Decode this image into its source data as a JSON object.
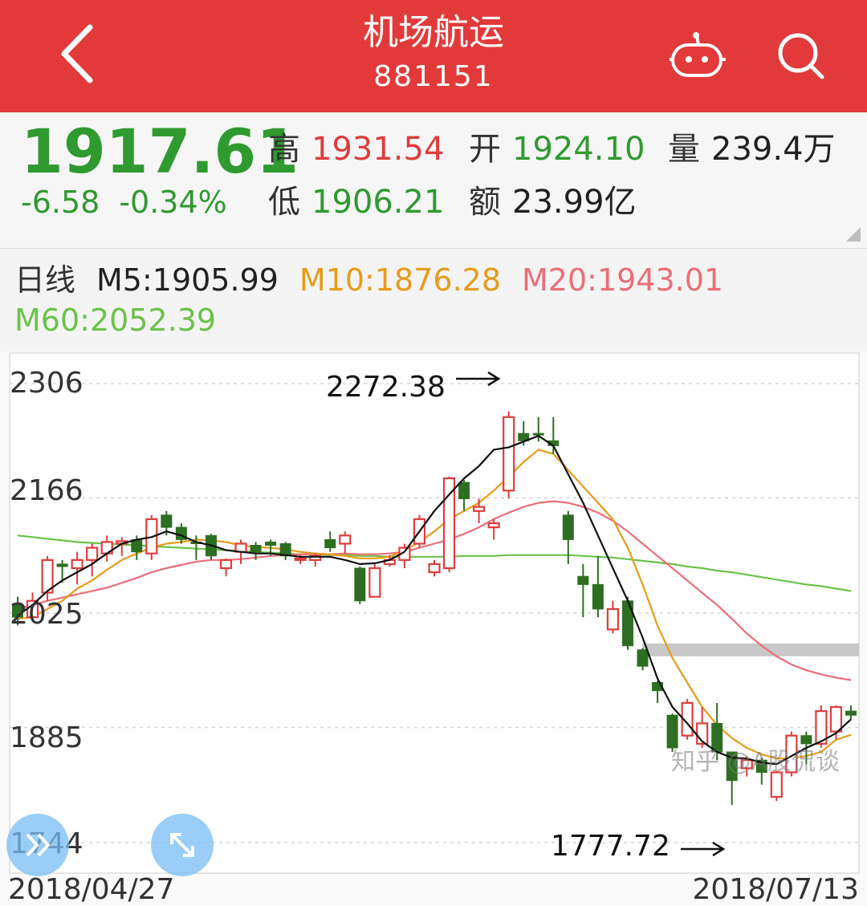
{
  "header": {
    "title": "机场航运",
    "code": "881151",
    "background": "#e23a3a"
  },
  "icons": {
    "back": "chevron-left-icon",
    "robot": "robot-icon",
    "search": "search-icon",
    "expand": "double-chevron-right-icon",
    "fullscreen": "expand-arrows-icon"
  },
  "quote": {
    "price": "1917.61",
    "change": "-6.58",
    "change_pct": "-0.34%",
    "high_label": "高",
    "high": "1931.54",
    "open_label": "开",
    "open": "1924.10",
    "volume_label": "量",
    "volume": "239.4万",
    "low_label": "低",
    "low": "1906.21",
    "amount_label": "额",
    "amount": "23.99亿"
  },
  "ma": {
    "kind": "日线",
    "m5": "M5:1905.99",
    "m10": "M10:1876.28",
    "m20": "M20:1943.01",
    "m60": "M60:2052.39"
  },
  "chart_data": {
    "type": "candlestick",
    "y_ticks": [
      "2306",
      "2166",
      "2025",
      "1885",
      "1744"
    ],
    "ylim": [
      1744,
      2306
    ],
    "x_start_label": "2018/04/27",
    "x_end_label": "2018/07/13",
    "high_annotation": "2272.38",
    "low_annotation": "1777.72",
    "colors": {
      "up": "#e03c3c",
      "down": "#2e6e22",
      "m5": "#111111",
      "m10": "#e89b1a",
      "m20": "#ec6e78",
      "m60": "#6cc24a"
    },
    "candles": [
      [
        2035,
        2020,
        2045,
        2010
      ],
      [
        2020,
        2040,
        2050,
        2015
      ],
      [
        2050,
        2090,
        2095,
        2040
      ],
      [
        2085,
        2082,
        2090,
        2062
      ],
      [
        2080,
        2090,
        2100,
        2060
      ],
      [
        2090,
        2105,
        2110,
        2070
      ],
      [
        2098,
        2112,
        2120,
        2088
      ],
      [
        2110,
        2113,
        2118,
        2095
      ],
      [
        2115,
        2100,
        2120,
        2090
      ],
      [
        2098,
        2140,
        2145,
        2090
      ],
      [
        2145,
        2130,
        2150,
        2120
      ],
      [
        2130,
        2115,
        2135,
        2110
      ],
      [
        2112,
        2110,
        2120,
        2090
      ],
      [
        2120,
        2095,
        2122,
        2090
      ],
      [
        2080,
        2090,
        2092,
        2070
      ],
      [
        2100,
        2110,
        2115,
        2085
      ],
      [
        2108,
        2100,
        2112,
        2090
      ],
      [
        2112,
        2108,
        2115,
        2095
      ],
      [
        2110,
        2095,
        2112,
        2090
      ],
      [
        2090,
        2092,
        2096,
        2085
      ],
      [
        2090,
        2095,
        2098,
        2082
      ],
      [
        2115,
        2105,
        2125,
        2100
      ],
      [
        2110,
        2120,
        2125,
        2098
      ],
      [
        2080,
        2040,
        2082,
        2036
      ],
      [
        2045,
        2080,
        2085,
        2045
      ],
      [
        2085,
        2090,
        2096,
        2082
      ],
      [
        2090,
        2105,
        2110,
        2080
      ],
      [
        2110,
        2140,
        2145,
        2105
      ],
      [
        2075,
        2085,
        2090,
        2070
      ],
      [
        2080,
        2190,
        2192,
        2075
      ],
      [
        2185,
        2165,
        2188,
        2150
      ],
      [
        2150,
        2155,
        2165,
        2135
      ],
      [
        2130,
        2135,
        2140,
        2115
      ],
      [
        2175,
        2265,
        2272,
        2165
      ],
      [
        2245,
        2236,
        2260,
        2230
      ],
      [
        2245,
        2244,
        2265,
        2235
      ],
      [
        2236,
        2230,
        2265,
        2220
      ],
      [
        2145,
        2115,
        2150,
        2085
      ],
      [
        2070,
        2060,
        2085,
        2020
      ],
      [
        2060,
        2030,
        2095,
        2020
      ],
      [
        2005,
        2030,
        2040,
        2000
      ],
      [
        2040,
        1985,
        2045,
        1980
      ],
      [
        1980,
        1960,
        1982,
        1955
      ],
      [
        1940,
        1930,
        1942,
        1915
      ],
      [
        1900,
        1860,
        1902,
        1855
      ],
      [
        1875,
        1915,
        1920,
        1870
      ],
      [
        1865,
        1890,
        1910,
        1860
      ],
      [
        1890,
        1855,
        1915,
        1845
      ],
      [
        1855,
        1820,
        1855,
        1790
      ],
      [
        1835,
        1845,
        1850,
        1825
      ],
      [
        1845,
        1830,
        1848,
        1815
      ],
      [
        1800,
        1830,
        1832,
        1795
      ],
      [
        1830,
        1875,
        1880,
        1825
      ],
      [
        1875,
        1865,
        1880,
        1840
      ],
      [
        1865,
        1905,
        1912,
        1860
      ],
      [
        1880,
        1910,
        1912,
        1870
      ],
      [
        1905,
        1900,
        1912,
        1895
      ]
    ],
    "m5": [
      2022,
      2035,
      2052,
      2065,
      2075,
      2085,
      2098,
      2110,
      2115,
      2118,
      2125,
      2120,
      2112,
      2108,
      2102,
      2100,
      2098,
      2098,
      2096,
      2094,
      2094,
      2094,
      2090,
      2085,
      2086,
      2090,
      2100,
      2125,
      2150,
      2170,
      2190,
      2205,
      2225,
      2228,
      2235,
      2242,
      2230,
      2195,
      2160,
      2120,
      2080,
      2040,
      1995,
      1945,
      1910,
      1890,
      1868,
      1855,
      1848,
      1847,
      1842,
      1840,
      1850,
      1860,
      1868,
      1878,
      1895
    ],
    "m10": [
      2018,
      2020,
      2030,
      2040,
      2055,
      2065,
      2078,
      2090,
      2098,
      2105,
      2110,
      2112,
      2115,
      2114,
      2112,
      2108,
      2106,
      2105,
      2103,
      2100,
      2098,
      2097,
      2095,
      2092,
      2092,
      2094,
      2102,
      2112,
      2125,
      2140,
      2150,
      2160,
      2175,
      2192,
      2210,
      2225,
      2220,
      2200,
      2180,
      2160,
      2140,
      2105,
      2060,
      2010,
      1970,
      1940,
      1910,
      1888,
      1872,
      1860,
      1852,
      1847,
      1847,
      1850,
      1855,
      1870,
      1876
    ],
    "m20": [
      2030,
      2035,
      2040,
      2044,
      2048,
      2052,
      2056,
      2062,
      2068,
      2075,
      2080,
      2084,
      2088,
      2090,
      2090,
      2091,
      2093,
      2095,
      2096,
      2097,
      2097,
      2097,
      2098,
      2097,
      2097,
      2098,
      2100,
      2105,
      2110,
      2115,
      2122,
      2130,
      2140,
      2148,
      2155,
      2160,
      2162,
      2160,
      2155,
      2148,
      2138,
      2125,
      2110,
      2095,
      2080,
      2065,
      2050,
      2035,
      2018,
      2000,
      1985,
      1972,
      1962,
      1955,
      1950,
      1946,
      1943
    ],
    "m60": [
      2120,
      2118,
      2116,
      2114,
      2112,
      2111,
      2110,
      2109,
      2108,
      2107,
      2106,
      2105,
      2104,
      2103,
      2102,
      2101,
      2100,
      2099,
      2098,
      2097,
      2097,
      2096,
      2096,
      2095,
      2095,
      2094,
      2094,
      2094,
      2094,
      2094,
      2095,
      2095,
      2095,
      2096,
      2096,
      2096,
      2096,
      2096,
      2095,
      2094,
      2093,
      2091,
      2089,
      2087,
      2085,
      2082,
      2080,
      2077,
      2075,
      2072,
      2069,
      2066,
      2063,
      2060,
      2058,
      2055,
      2052
    ]
  },
  "watermark": "知乎 @A股侃谈"
}
